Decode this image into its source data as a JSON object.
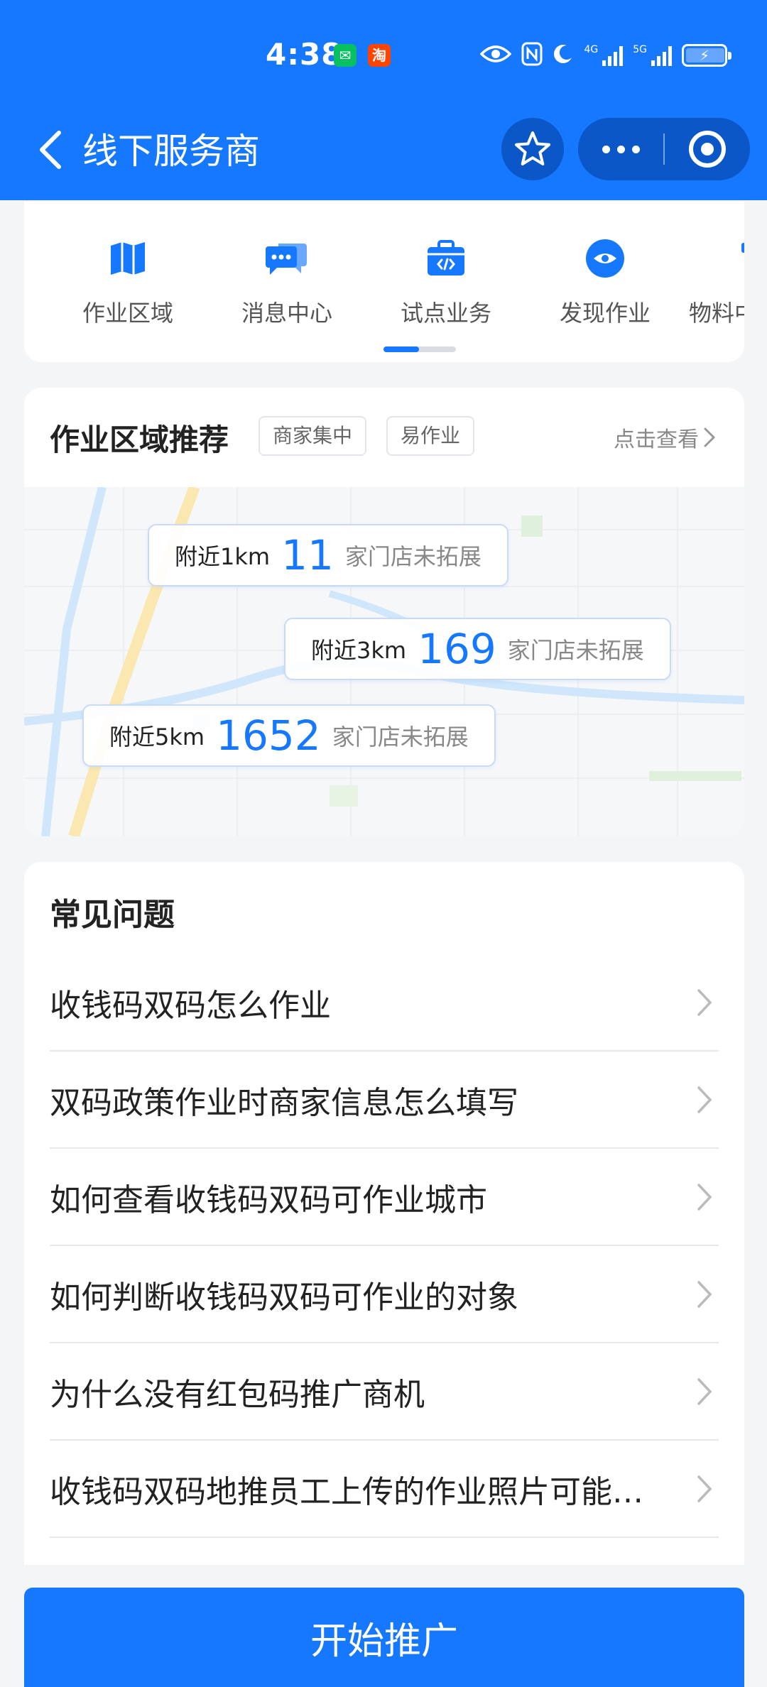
{
  "status_bar": {
    "time": "4:38",
    "app_icons": [
      {
        "name": "wechat-icon",
        "glyph": "✉"
      },
      {
        "name": "taobao-icon",
        "glyph": "淘"
      }
    ],
    "signal_labels": [
      "4G",
      "5G"
    ]
  },
  "navbar": {
    "title": "线下服务商"
  },
  "shortcuts": {
    "items": [
      {
        "label": "作业区域",
        "icon": "book-map-icon"
      },
      {
        "label": "消息中心",
        "icon": "chat-bubble-icon"
      },
      {
        "label": "试点业务",
        "icon": "briefcase-code-icon"
      },
      {
        "label": "发现作业",
        "icon": "eye-icon"
      },
      {
        "label": "物料中",
        "icon": "material-box-icon"
      }
    ],
    "scroll_position": 0.5
  },
  "area_recommend": {
    "title": "作业区域推荐",
    "tags": [
      "商家集中",
      "易作业"
    ],
    "view_link": "点击查看",
    "stats": [
      {
        "distance": "附近1km",
        "count": "11",
        "desc": "家门店未拓展"
      },
      {
        "distance": "附近3km",
        "count": "169",
        "desc": "家门店未拓展"
      },
      {
        "distance": "附近5km",
        "count": "1652",
        "desc": "家门店未拓展"
      }
    ]
  },
  "faq": {
    "title": "常见问题",
    "items": [
      "收钱码双码怎么作业",
      "双码政策作业时商家信息怎么填写",
      "如何查看收钱码双码可作业城市",
      "如何判断收钱码双码可作业的对象",
      "为什么没有红包码推广商机",
      "收钱码双码地推员工上传的作业照片可能会被驳回的原因"
    ]
  },
  "bottom": {
    "start_label": "开始推广"
  },
  "colors": {
    "brand": "#1677ff",
    "capsule": "#0b57c8",
    "background": "#f4f5f7"
  }
}
